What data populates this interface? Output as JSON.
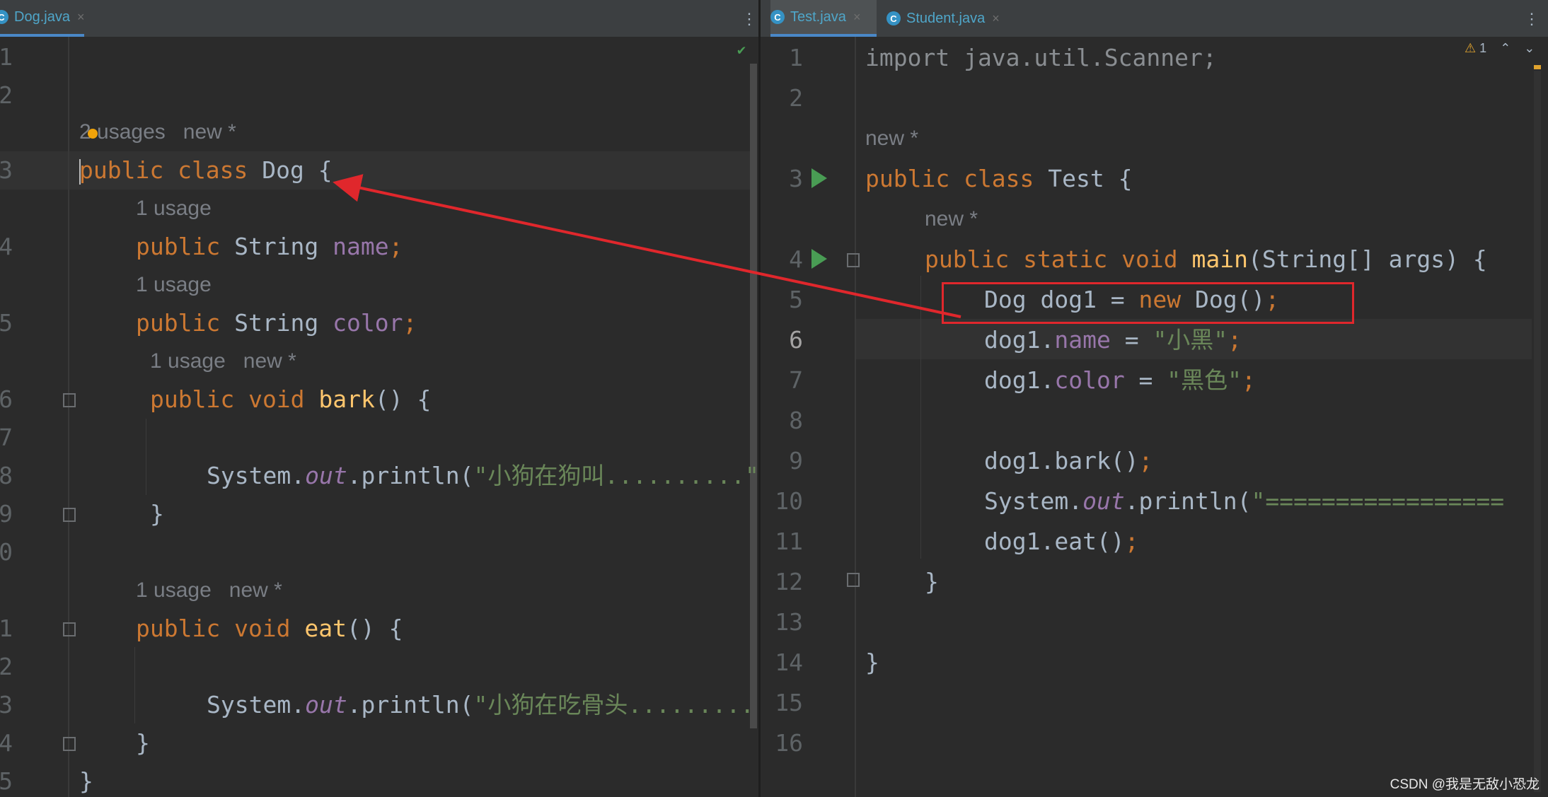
{
  "left_editor": {
    "tabs": [
      {
        "label": "Dog.java",
        "close": "×"
      }
    ],
    "hints": {
      "class_hint": "2 usages   new *",
      "name_hint": "1 usage",
      "color_hint": "1 usage",
      "bark_hint": "1 usage   new *",
      "eat_hint": "1 usage   new *"
    },
    "line_numbers": [
      "1",
      "2",
      "3",
      "4",
      "5",
      "6",
      "7",
      "8",
      "9",
      "0",
      "1",
      "2",
      "3",
      "4",
      "5"
    ],
    "code": {
      "l3_kw": "public class ",
      "l3_name": "Dog {",
      "l4_kw": "public ",
      "l4_type": "String ",
      "l4_field": "name",
      "l5_kw": "public ",
      "l5_type": "String ",
      "l5_field": "color",
      "semi": ";",
      "l6_kw": "public void ",
      "l6_fn": "bark",
      "l6_rest": "() {",
      "l8_a": "System.",
      "l8_out": "out",
      "l8_b": ".println(",
      "l8_str": "\"小狗在狗叫..........\"",
      "l9": "}",
      "l11_kw": "public void ",
      "l11_fn": "eat",
      "l11_rest": "() {",
      "l13_str": "\"小狗在吃骨头.........",
      "l14": "}",
      "l15": "}"
    }
  },
  "right_editor": {
    "tabs": [
      {
        "label": "Test.java",
        "close": "×"
      },
      {
        "label": "Student.java",
        "close": "×"
      }
    ],
    "inspection": "1",
    "hints": {
      "class_hint": "new *",
      "main_hint": "new *"
    },
    "line_numbers": [
      "1",
      "2",
      "3",
      "4",
      "5",
      "6",
      "7",
      "8",
      "9",
      "10",
      "11",
      "12",
      "13",
      "14",
      "15",
      "16"
    ],
    "code": {
      "l1": "import java.util.Scanner;",
      "l3_kw": "public class ",
      "l3_name": "Test {",
      "l4_kw": "public static void ",
      "l4_fn": "main",
      "l4_rest": "(String[] args) {",
      "l5_a": "Dog dog1 = ",
      "l5_new": "new ",
      "l5_b": "Dog()",
      "l6_a": "dog1.",
      "l6_field": "name",
      "l6_eq": " = ",
      "l6_str": "\"小黑\"",
      "l7_a": "dog1.",
      "l7_field": "color",
      "l7_eq": " = ",
      "l7_str": "\"黑色\"",
      "l9": "dog1.bark()",
      "l10_a": "System.",
      "l10_out": "out",
      "l10_b": ".println(",
      "l10_str": "\"=================",
      "l11": "dog1.eat()",
      "l12": "}",
      "l14": "}",
      "semi": ";"
    }
  },
  "watermark": "CSDN @我是无敌小恐龙",
  "icons": {
    "class_tab_icon": "C",
    "kebab": "⋮",
    "check": "✔",
    "warning": "⚠",
    "up": "⌃",
    "down": "⌄"
  }
}
